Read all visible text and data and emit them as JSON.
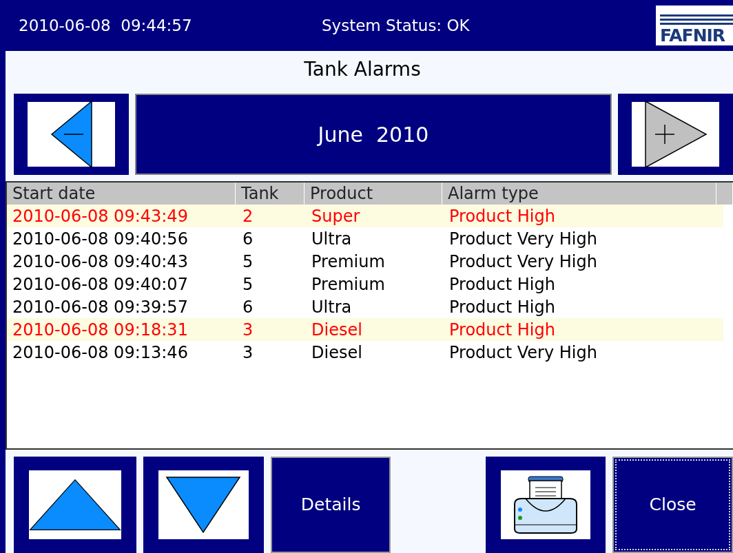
{
  "header": {
    "datetime": "2010-06-08  09:44:57",
    "status": "System Status: OK",
    "logo": "FAFNIR"
  },
  "title": "Tank Alarms",
  "period": {
    "label": "June  2010",
    "prev": {
      "disabled": false
    },
    "next": {
      "disabled": true
    }
  },
  "table": {
    "columns": [
      "Start date",
      "Tank",
      "Product",
      "Alarm type"
    ],
    "rows": [
      {
        "cells": [
          "2010-06-08 09:43:49",
          "2",
          "Super",
          "Product High"
        ],
        "alarm": true
      },
      {
        "cells": [
          "2010-06-08 09:40:56",
          "6",
          "Ultra",
          "Product Very High"
        ],
        "alarm": false
      },
      {
        "cells": [
          "2010-06-08 09:40:43",
          "5",
          "Premium",
          "Product Very High"
        ],
        "alarm": false
      },
      {
        "cells": [
          "2010-06-08 09:40:07",
          "5",
          "Premium",
          "Product High"
        ],
        "alarm": false
      },
      {
        "cells": [
          "2010-06-08 09:39:57",
          "6",
          "Ultra",
          "Product High"
        ],
        "alarm": false
      },
      {
        "cells": [
          "2010-06-08 09:18:31",
          "3",
          "Diesel",
          "Product High"
        ],
        "alarm": true
      },
      {
        "cells": [
          "2010-06-08 09:13:46",
          "3",
          "Diesel",
          "Product Very High"
        ],
        "alarm": false
      }
    ]
  },
  "buttons": [
    {
      "kind": "up",
      "focused": false
    },
    {
      "kind": "down",
      "focused": false
    },
    {
      "kind": "text",
      "label": "Details",
      "focused": false
    },
    {
      "kind": "print",
      "focused": false
    },
    {
      "kind": "text",
      "label": "Close",
      "focused": true
    }
  ]
}
